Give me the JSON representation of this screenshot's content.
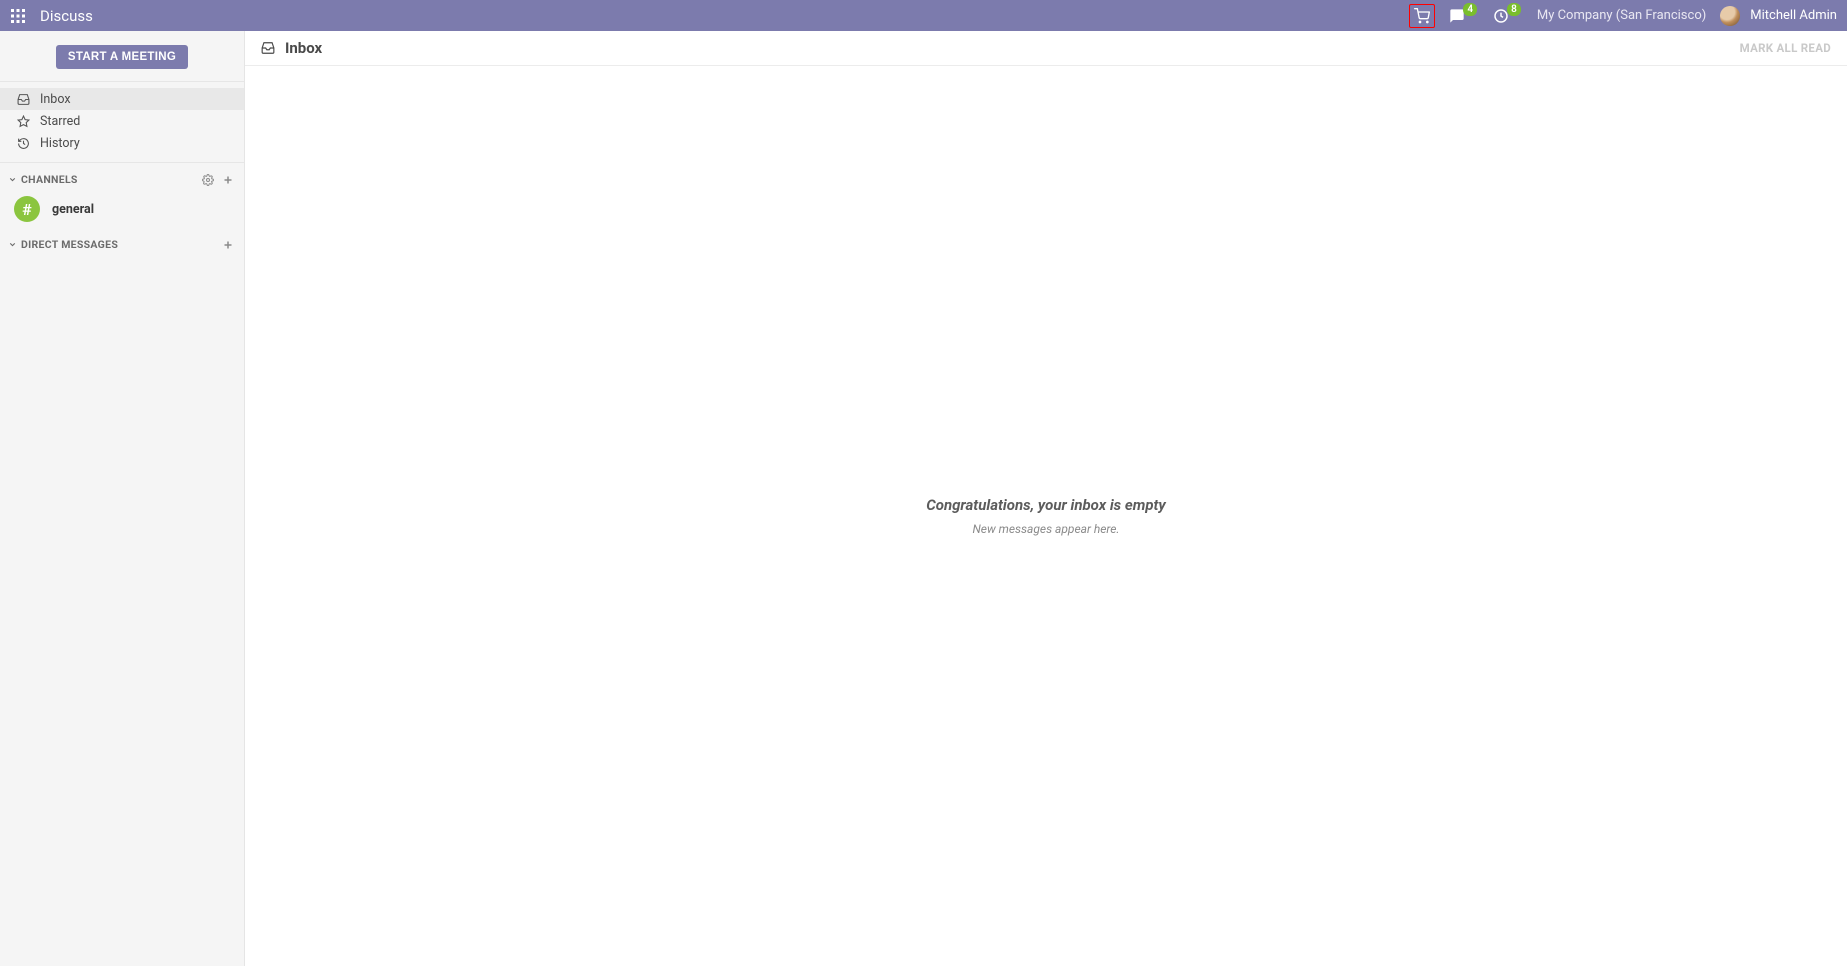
{
  "navbar": {
    "app_title": "Discuss",
    "messages_badge": "4",
    "activity_badge": "8",
    "company": "My Company (San Francisco)",
    "user_name": "Mitchell Admin"
  },
  "sidebar": {
    "start_meeting_label": "START A MEETING",
    "mailboxes": [
      {
        "key": "inbox",
        "label": "Inbox",
        "icon": "inbox-icon",
        "active": true
      },
      {
        "key": "starred",
        "label": "Starred",
        "icon": "star-icon",
        "active": false
      },
      {
        "key": "history",
        "label": "History",
        "icon": "history-icon",
        "active": false
      }
    ],
    "channels_section_label": "CHANNELS",
    "channels": [
      {
        "name": "general",
        "hash": "#"
      }
    ],
    "dm_section_label": "DIRECT MESSAGES"
  },
  "content": {
    "header_title": "Inbox",
    "mark_all_read_label": "MARK ALL READ",
    "empty_title": "Congratulations, your inbox is empty",
    "empty_subtitle": "New messages appear here."
  }
}
